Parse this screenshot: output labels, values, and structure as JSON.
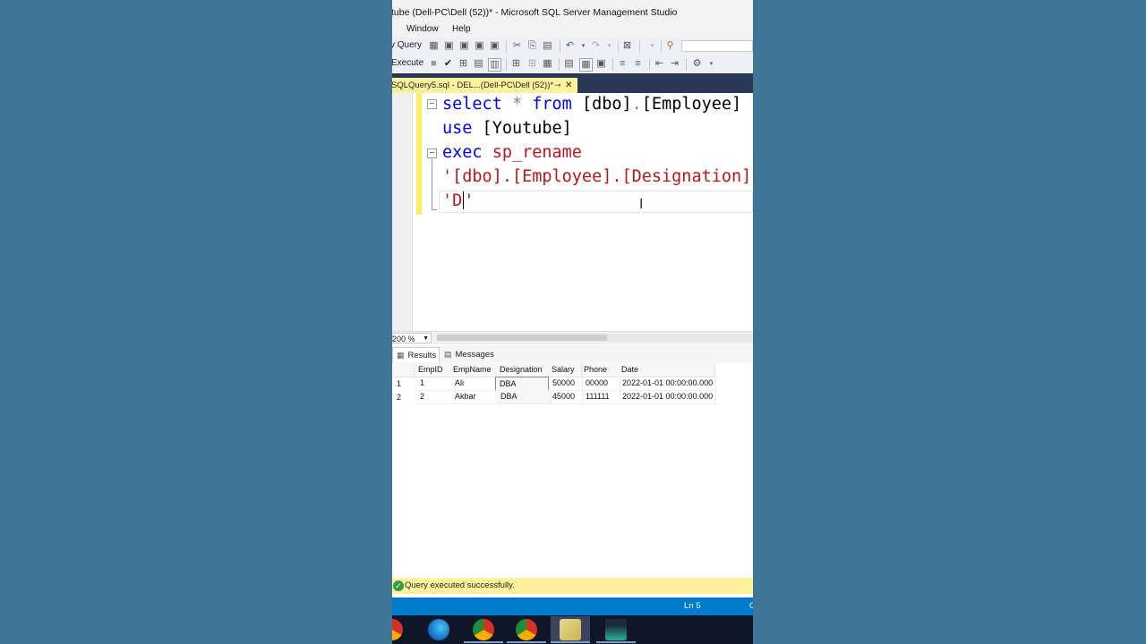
{
  "window": {
    "title": "tube (Dell-PC\\Dell (52))* - Microsoft SQL Server Management Studio"
  },
  "menu": {
    "items": [
      "Window",
      "Help"
    ]
  },
  "toolbar": {
    "new_query_label": "v Query",
    "execute_label": "Execute"
  },
  "document_tab": {
    "label": "SQLQuery5.sql - DEL...(Dell-PC\\Dell (52))*",
    "pin_icon": "pin-icon",
    "close_icon": "close-icon"
  },
  "editor": {
    "lines": [
      [
        {
          "t": "kw",
          "v": "select"
        },
        {
          "t": "gr",
          "v": " * "
        },
        {
          "t": "kw",
          "v": "from"
        },
        {
          "t": "tx",
          "v": " [dbo]"
        },
        {
          "t": "gr",
          "v": "."
        },
        {
          "t": "tx",
          "v": "[Employee]"
        }
      ],
      [
        {
          "t": "kw",
          "v": "use"
        },
        {
          "t": "tx",
          "v": " [Youtube]"
        }
      ],
      [
        {
          "t": "kw",
          "v": "exec"
        },
        {
          "t": "tx",
          "v": " "
        },
        {
          "t": "st",
          "v": "sp_rename"
        }
      ],
      [
        {
          "t": "st",
          "v": "'[dbo].[Employee].[Designation]"
        }
      ],
      [
        {
          "t": "st",
          "v": "'D"
        },
        {
          "t": "caret",
          "v": ""
        },
        {
          "t": "st",
          "v": "'"
        }
      ]
    ]
  },
  "zoom": {
    "value": "200 %"
  },
  "results": {
    "tabs": [
      "Results",
      "Messages"
    ],
    "columns": [
      "EmpID",
      "EmpName",
      "Designation",
      "Salary",
      "Phone",
      "Date"
    ],
    "rows": [
      {
        "num": "1",
        "cells": [
          "1",
          "Ali",
          "DBA",
          "50000",
          "00000",
          "2022-01-01 00:00:00.000"
        ]
      },
      {
        "num": "2",
        "cells": [
          "2",
          "Akbar",
          "DBA",
          "45000",
          "111111",
          "2022-01-01 00:00:00.000"
        ]
      }
    ]
  },
  "query_status": {
    "message": "Query executed successfully."
  },
  "statusbar": {
    "line": "Ln 5",
    "col": "C"
  },
  "taskbar": {
    "apps": [
      "chrome-icon",
      "edge-icon",
      "chrome-icon",
      "chrome-icon",
      "ssms-icon",
      "app-icon"
    ]
  }
}
